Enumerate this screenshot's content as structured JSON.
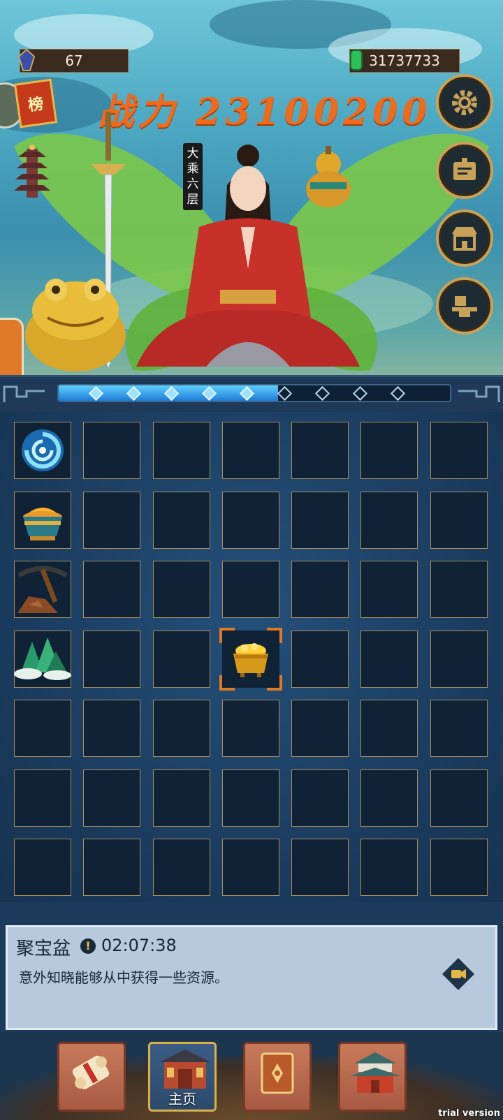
{
  "resources": {
    "left_value": "67",
    "left_icon": "blue-crystal-icon",
    "right_value": "31737733",
    "right_icon": "green-jade-icon"
  },
  "power": {
    "label": "战力",
    "value": "23100200",
    "color": "#f06a1c"
  },
  "rank_badge": "榜",
  "realm": "大乘六层",
  "side_buttons": [
    "settings-gear-icon",
    "notice-board-icon",
    "shop-icon",
    "forge-anvil-icon"
  ],
  "progress": {
    "filled_segments": 5,
    "total_segments": 9,
    "fraction": 0.56
  },
  "grid": {
    "rows": 7,
    "cols": 7,
    "items": [
      {
        "row": 0,
        "col": 0,
        "icon": "vortex-icon"
      },
      {
        "row": 1,
        "col": 0,
        "icon": "treasure-basin-icon"
      },
      {
        "row": 2,
        "col": 0,
        "icon": "pickaxe-ore-icon"
      },
      {
        "row": 3,
        "col": 0,
        "icon": "jade-mountain-icon"
      },
      {
        "row": 3,
        "col": 3,
        "icon": "gold-pot-icon",
        "selected": true
      }
    ]
  },
  "info_panel": {
    "name": "聚宝盆",
    "timer": "02:07:38",
    "description": "意外知晓能够从中获得一些资源。"
  },
  "nav": {
    "items": [
      {
        "icon": "scroll-icon",
        "label": ""
      },
      {
        "icon": "main-hall-icon",
        "label": "主页",
        "active": true
      },
      {
        "icon": "book-icon",
        "label": ""
      },
      {
        "icon": "pavilion-icon",
        "label": ""
      }
    ]
  },
  "watermark": "trial version"
}
